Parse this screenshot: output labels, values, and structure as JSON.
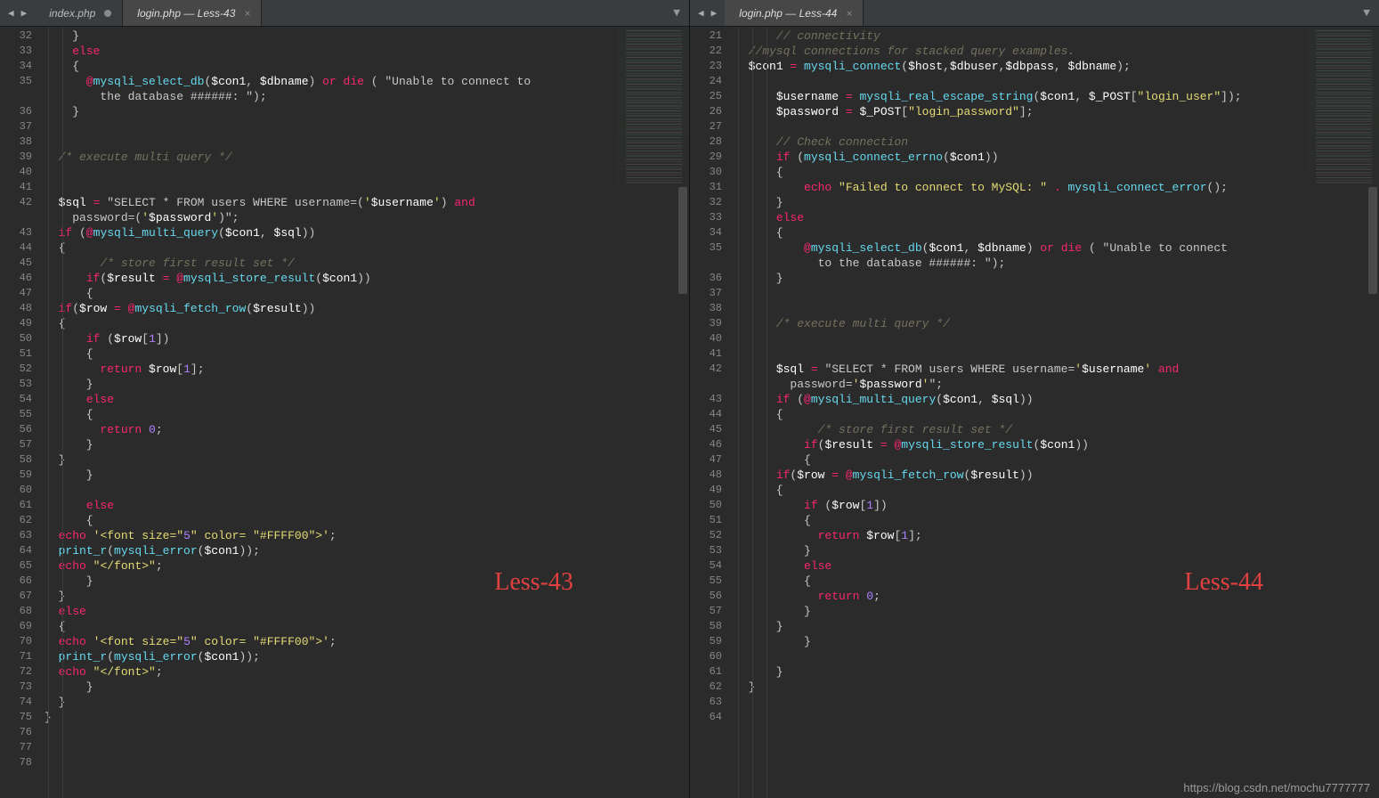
{
  "leftPane": {
    "tabs": [
      {
        "label": "index.php",
        "active": false,
        "dirty": true
      },
      {
        "label": "login.php — Less-43",
        "active": true,
        "dirty": false
      }
    ],
    "overlay": "Less-43",
    "startLine": 32,
    "code": [
      "    }",
      "    else",
      "    {",
      "      @mysqli_select_db($con1, $dbname) or die ( \"Unable to connect to the database ######: \");",
      "    }",
      "",
      "",
      "  /* execute multi query */",
      "",
      "",
      "  $sql = \"SELECT * FROM users WHERE username=('$username') and password=('$password')\";",
      "  if (@mysqli_multi_query($con1, $sql))",
      "  {",
      "        /* store first result set */",
      "      if($result = @mysqli_store_result($con1))",
      "      {",
      "  if($row = @mysqli_fetch_row($result))",
      "  {",
      "      if ($row[1])",
      "      {",
      "        return $row[1];",
      "      }",
      "      else",
      "      {",
      "        return 0;",
      "      }",
      "  }",
      "      }",
      "",
      "      else",
      "      {",
      "  echo '<font size=\"5\" color= \"#FFFF00\">';",
      "  print_r(mysqli_error($con1));",
      "  echo \"</font>\";",
      "      }",
      "  }",
      "  else",
      "  {",
      "  echo '<font size=\"5\" color= \"#FFFF00\">';",
      "  print_r(mysqli_error($con1));",
      "  echo \"</font>\";",
      "      }",
      "  }",
      "}",
      "",
      "",
      ""
    ]
  },
  "rightPane": {
    "tabs": [
      {
        "label": "login.php — Less-44",
        "active": true,
        "dirty": false
      }
    ],
    "overlay": "Less-44",
    "startLine": 21,
    "code": [
      "      // connectivity",
      "  //mysql connections for stacked query examples.",
      "  $con1 = mysqli_connect($host,$dbuser,$dbpass, $dbname);",
      "",
      "      $username = mysqli_real_escape_string($con1, $_POST[\"login_user\"]);",
      "      $password = $_POST[\"login_password\"];",
      "",
      "      // Check connection",
      "      if (mysqli_connect_errno($con1))",
      "      {",
      "          echo \"Failed to connect to MySQL: \" . mysqli_connect_error();",
      "      }",
      "      else",
      "      {",
      "          @mysqli_select_db($con1, $dbname) or die ( \"Unable to connect to the database ######: \");",
      "      }",
      "",
      "",
      "      /* execute multi query */",
      "",
      "",
      "      $sql = \"SELECT * FROM users WHERE username='$username' and password='$password'\";",
      "      if (@mysqli_multi_query($con1, $sql))",
      "      {",
      "            /* store first result set */",
      "          if($result = @mysqli_store_result($con1))",
      "          {",
      "      if($row = @mysqli_fetch_row($result))",
      "      {",
      "          if ($row[1])",
      "          {",
      "            return $row[1];",
      "          }",
      "          else",
      "          {",
      "            return 0;",
      "          }",
      "      }",
      "          }",
      "",
      "      }",
      "  }",
      "",
      ""
    ]
  },
  "watermark": "https://blog.csdn.net/mochu7777777",
  "colors": {
    "background": "#2b2b2b",
    "keyword": "#F92672",
    "function": "#66D9EF",
    "string": "#E6DB74",
    "number": "#AE81FF",
    "comment": "#75715E"
  }
}
